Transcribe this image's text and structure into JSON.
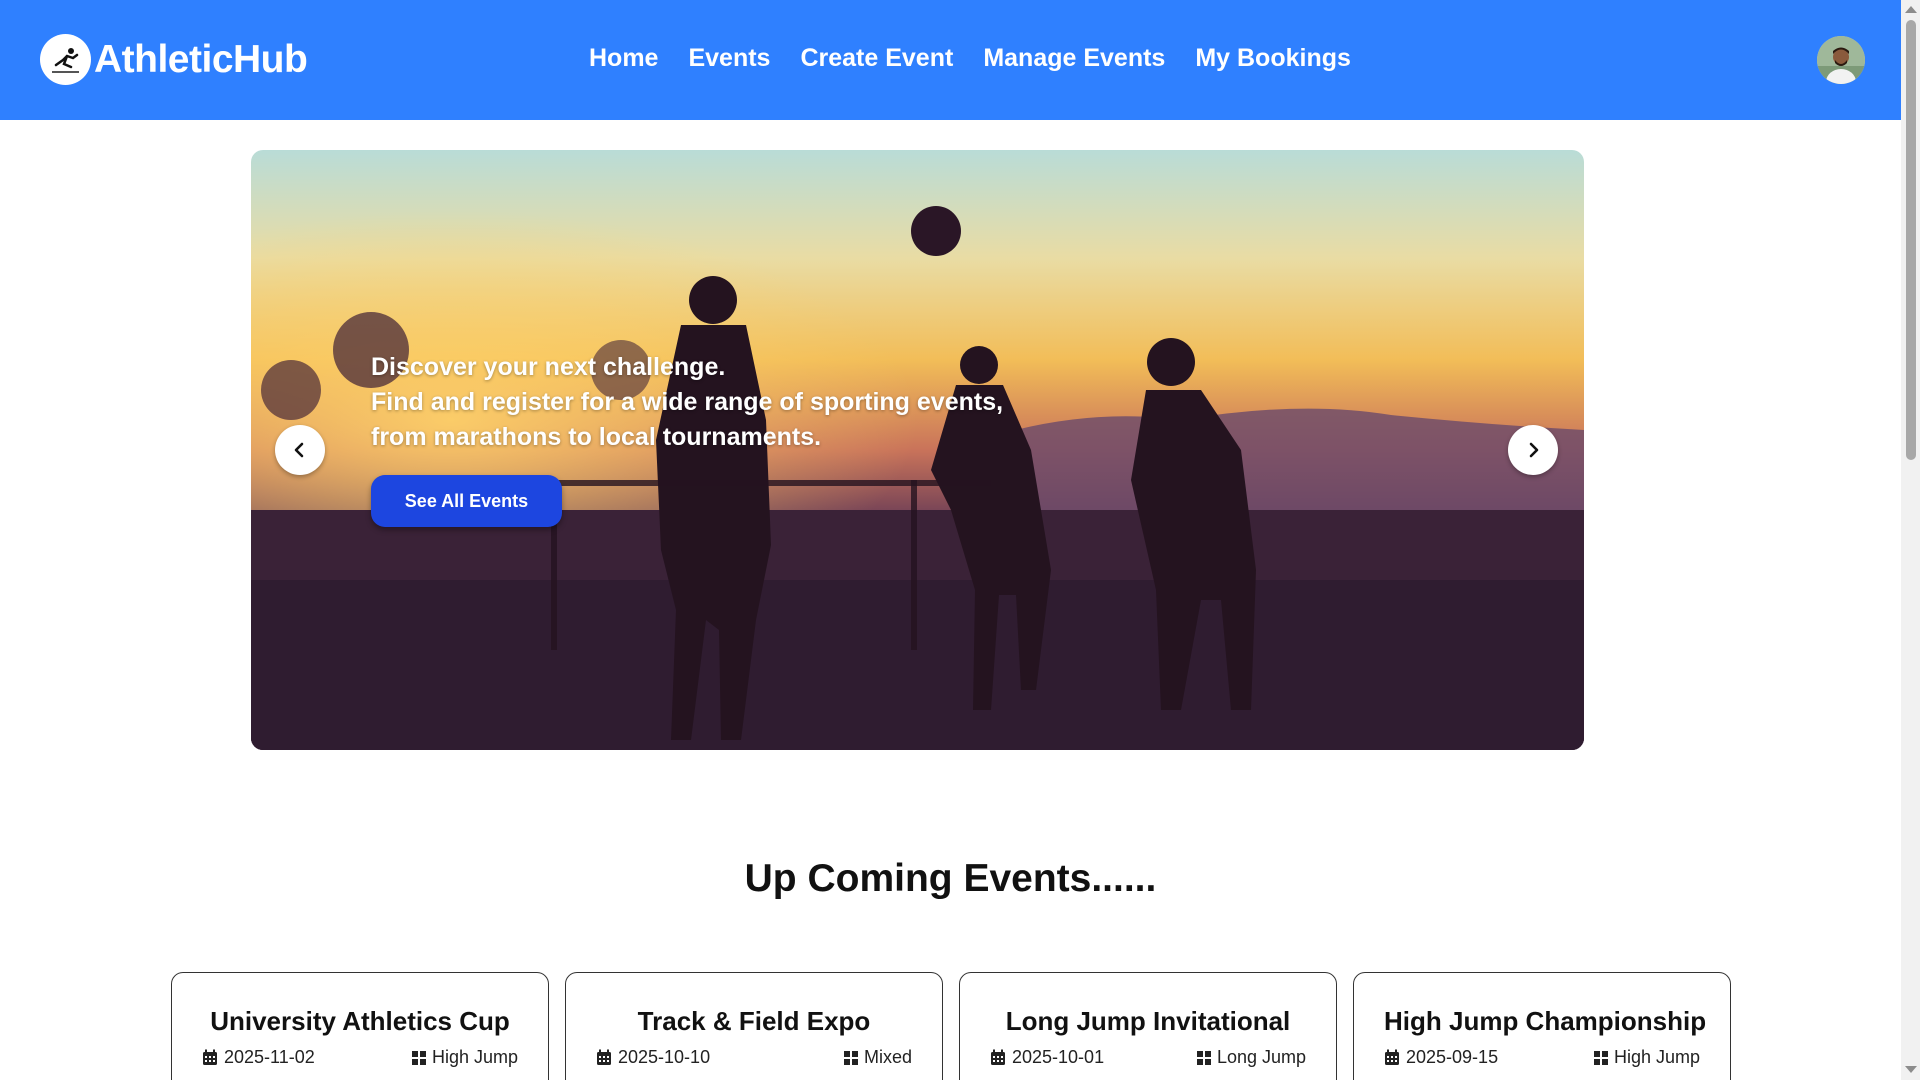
{
  "brand": {
    "name": "AthleticHub",
    "logo_icon": "runner-logo-icon"
  },
  "nav": {
    "items": [
      {
        "label": "Home"
      },
      {
        "label": "Events"
      },
      {
        "label": "Create Event"
      },
      {
        "label": "Manage Events"
      },
      {
        "label": "My Bookings"
      }
    ]
  },
  "hero": {
    "line1": "Discover your next challenge.",
    "line2": "Find and register for a wide range of sporting events,",
    "line3": "from marathons to local tournaments.",
    "cta_label": "See All Events",
    "prev_glyph": "‹",
    "next_glyph": "›"
  },
  "section": {
    "title": "Up Coming Events......"
  },
  "events": [
    {
      "title": "University Athletics Cup",
      "date": "2025-11-02",
      "category": "High Jump"
    },
    {
      "title": "Track & Field Expo",
      "date": "2025-10-10",
      "category": "Mixed"
    },
    {
      "title": "Long Jump Invitational",
      "date": "2025-10-01",
      "category": "Long Jump"
    },
    {
      "title": "High Jump Championship",
      "date": "2025-09-15",
      "category": "High Jump"
    }
  ],
  "colors": {
    "navbar": "#2f80ff",
    "cta": "#1d46e0",
    "text": "#111111"
  }
}
